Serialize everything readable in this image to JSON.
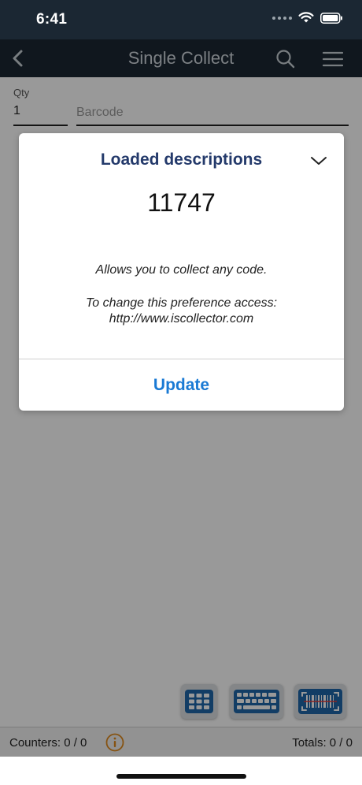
{
  "status_bar": {
    "time": "6:41"
  },
  "nav": {
    "title": "Single Collect"
  },
  "form": {
    "qty_label": "Qty",
    "qty_value": "1",
    "barcode_placeholder": "Barcode"
  },
  "footer": {
    "counters": "Counters: 0 / 0",
    "totals": "Totals: 0 / 0"
  },
  "modal": {
    "title": "Loaded descriptions",
    "count": "11747",
    "message": "Allows you to collect any code.",
    "pref_line1": "To change this preference access:",
    "pref_line2": "http://www.iscollector.com",
    "update_label": "Update"
  },
  "colors": {
    "header_bg": "#1b2733",
    "modal_title": "#243a6b",
    "accent_blue": "#1a7ad4",
    "tool_icon_blue": "#1e66a8",
    "info_orange": "#e08a1e"
  },
  "icons": {
    "back": "chevron-left-icon",
    "search": "search-icon",
    "menu": "hamburger-menu-icon",
    "numpad": "numpad-icon",
    "keyboard": "keyboard-icon",
    "scanner": "barcode-scanner-icon",
    "info": "info-icon",
    "modal_chevron": "chevron-down-icon"
  }
}
